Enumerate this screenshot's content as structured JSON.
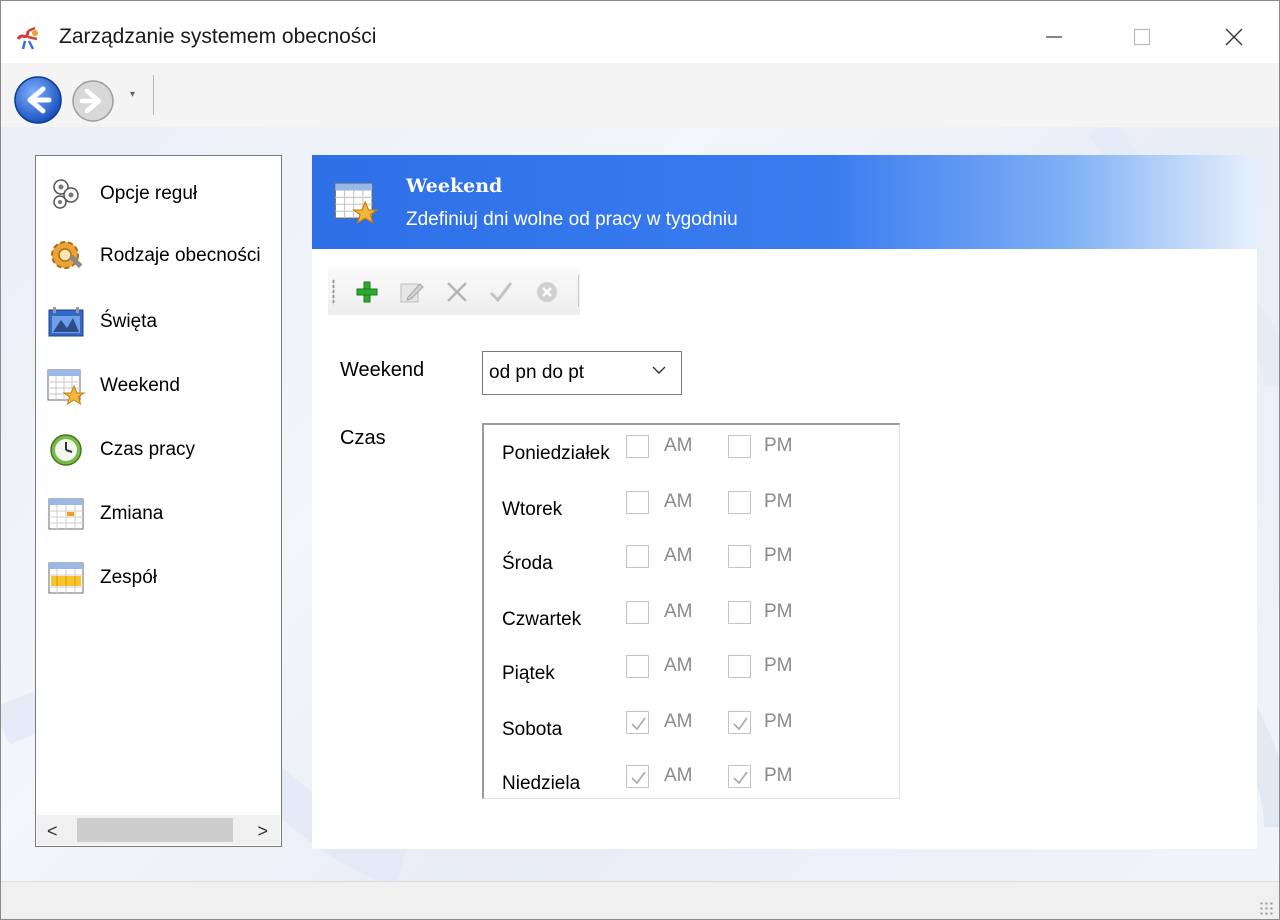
{
  "window": {
    "title": "Zarządzanie systemem obecności",
    "controls": {
      "minimize": "—",
      "maximize": "☐",
      "close": "✕"
    }
  },
  "nav": {
    "back_icon": "back-arrow-icon",
    "forward_icon": "forward-arrow-icon",
    "dropdown": "▾"
  },
  "sidebar": {
    "items": [
      {
        "label": "Opcje reguł",
        "icon": "gears-icon"
      },
      {
        "label": "Rodzaje obecności",
        "icon": "gear-wrench-icon"
      },
      {
        "label": "Święta",
        "icon": "holiday-calendar-icon"
      },
      {
        "label": "Weekend",
        "icon": "calendar-star-icon"
      },
      {
        "label": "Czas pracy",
        "icon": "clock-icon"
      },
      {
        "label": "Zmiana",
        "icon": "shift-grid-icon"
      },
      {
        "label": "Zespół",
        "icon": "team-grid-icon"
      }
    ],
    "scroll": {
      "left": "<",
      "right": ">"
    }
  },
  "header": {
    "title": "Weekend",
    "subtitle": "Zdefiniuj dni wolne od pracy w tygodniu"
  },
  "toolbar": {
    "buttons": [
      {
        "name": "add",
        "icon": "plus-icon",
        "enabled": true
      },
      {
        "name": "edit",
        "icon": "edit-icon",
        "enabled": false
      },
      {
        "name": "delete",
        "icon": "delete-x-icon",
        "enabled": false
      },
      {
        "name": "save",
        "icon": "check-icon",
        "enabled": false
      },
      {
        "name": "cancel",
        "icon": "cancel-icon",
        "enabled": false
      }
    ]
  },
  "form": {
    "weekend_label": "Weekend",
    "weekend_value": "od pn do pt",
    "czas_label": "Czas",
    "am_label": "AM",
    "pm_label": "PM",
    "days": [
      {
        "name": "Poniedziałek",
        "am": false,
        "pm": false
      },
      {
        "name": "Wtorek",
        "am": false,
        "pm": false
      },
      {
        "name": "Środa",
        "am": false,
        "pm": false
      },
      {
        "name": "Czwartek",
        "am": false,
        "pm": false
      },
      {
        "name": "Piątek",
        "am": false,
        "pm": false
      },
      {
        "name": "Sobota",
        "am": true,
        "pm": true
      },
      {
        "name": "Niedziela",
        "am": true,
        "pm": true
      }
    ]
  },
  "colors": {
    "header_blue": "#2d6fe6",
    "add_green": "#2ea82e"
  }
}
